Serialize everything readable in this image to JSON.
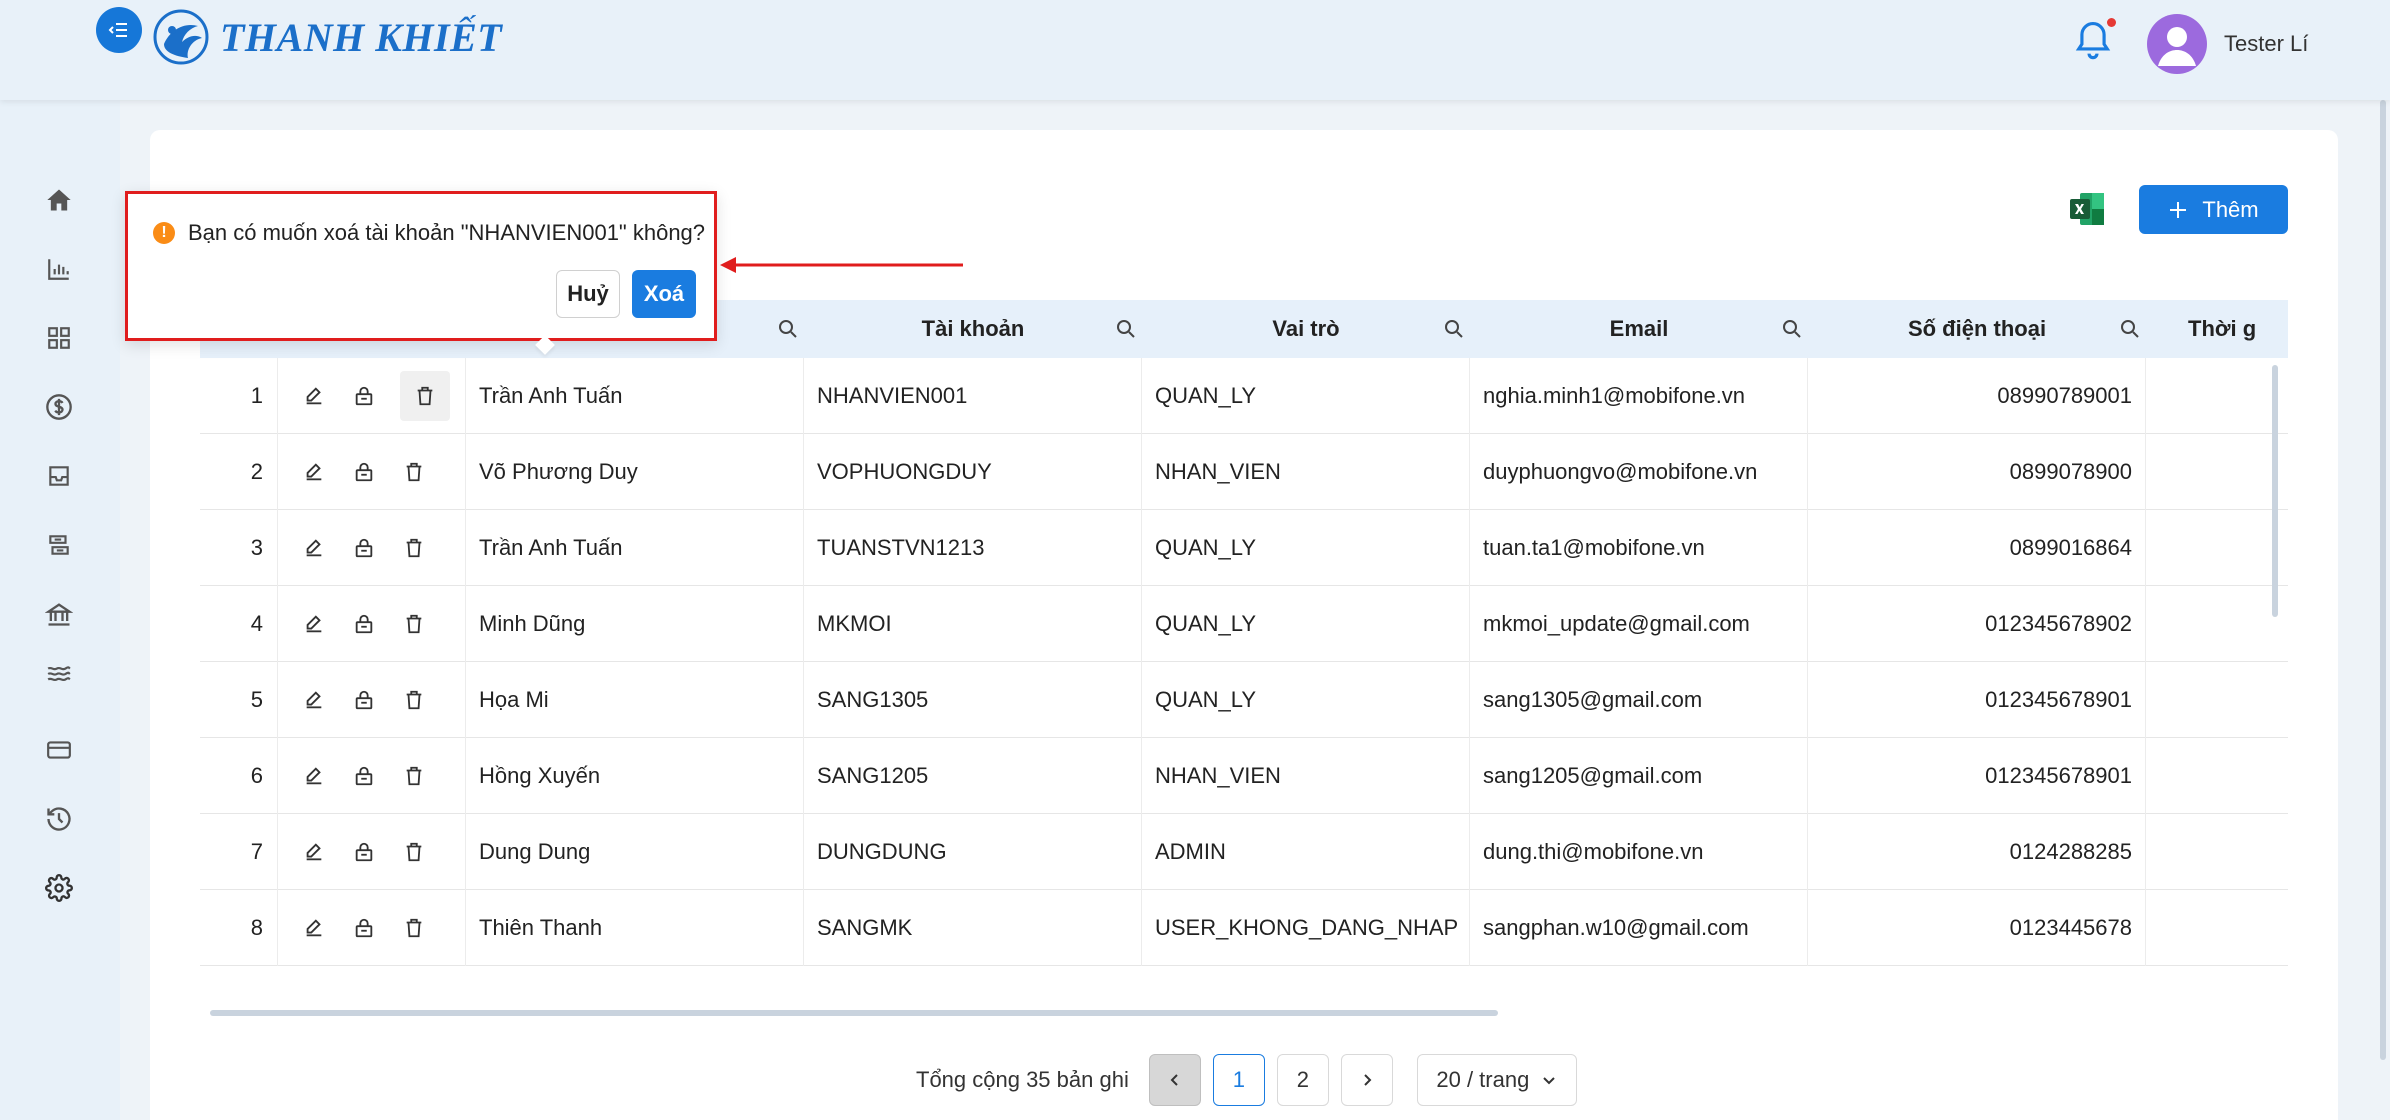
{
  "app": {
    "logo_text": "THANH KHIẾT",
    "user_name": "Tester Lí"
  },
  "colors": {
    "primary": "#1a7ce0",
    "warning": "#fa8c16",
    "annotation": "#e01d1d"
  },
  "sidebar": {
    "items": [
      {
        "icon": "home-icon"
      },
      {
        "icon": "bar-chart-icon"
      },
      {
        "icon": "grid-icon"
      },
      {
        "icon": "dollar-icon"
      },
      {
        "icon": "inbox-icon"
      },
      {
        "icon": "transfer-icon"
      },
      {
        "icon": "bank-icon"
      },
      {
        "icon": "waves-icon"
      },
      {
        "icon": "wallet-icon"
      },
      {
        "icon": "history-icon"
      },
      {
        "icon": "settings-icon"
      }
    ]
  },
  "toolbar": {
    "add_label": "Thêm"
  },
  "table": {
    "columns": [
      "Tài khoản",
      "Vai trò",
      "Email",
      "Số điện thoại",
      "Thời g"
    ],
    "rows": [
      {
        "stt": "1",
        "name": "Trần Anh Tuấn",
        "account": "NHANVIEN001",
        "role": "QUAN_LY",
        "email": "nghia.minh1@mobifone.vn",
        "phone": "08990789001"
      },
      {
        "stt": "2",
        "name": "Võ Phương Duy",
        "account": "VOPHUONGDUY",
        "role": "NHAN_VIEN",
        "email": "duyphuongvo@mobifone.vn",
        "phone": "0899078900"
      },
      {
        "stt": "3",
        "name": "Trần Anh Tuấn",
        "account": "TUANSTVN1213",
        "role": "QUAN_LY",
        "email": "tuan.ta1@mobifone.vn",
        "phone": "0899016864"
      },
      {
        "stt": "4",
        "name": "Minh Dũng",
        "account": "MKMOI",
        "role": "QUAN_LY",
        "email": "mkmoi_update@gmail.com",
        "phone": "012345678902"
      },
      {
        "stt": "5",
        "name": "Họa Mi",
        "account": "SANG1305",
        "role": "QUAN_LY",
        "email": "sang1305@gmail.com",
        "phone": "012345678901"
      },
      {
        "stt": "6",
        "name": "Hồng Xuyến",
        "account": "SANG1205",
        "role": "NHAN_VIEN",
        "email": "sang1205@gmail.com",
        "phone": "012345678901"
      },
      {
        "stt": "7",
        "name": "Dung Dung",
        "account": "DUNGDUNG",
        "role": "ADMIN",
        "email": "dung.thi@mobifone.vn",
        "phone": "0124288285"
      },
      {
        "stt": "8",
        "name": "Thiên Thanh",
        "account": "SANGMK",
        "role": "USER_KHONG_DANG_NHAP",
        "email": "sangphan.w10@gmail.com",
        "phone": "0123445678"
      }
    ]
  },
  "pagination": {
    "total_text": "Tổng cộng 35 bản ghi",
    "pages": [
      "1",
      "2"
    ],
    "current_page": "1",
    "page_size": "20 / trang"
  },
  "popconfirm": {
    "message": "Bạn có muốn xoá tài khoản \"NHANVIEN001\" không?",
    "cancel_label": "Huỷ",
    "ok_label": "Xoá",
    "warn_glyph": "!"
  }
}
